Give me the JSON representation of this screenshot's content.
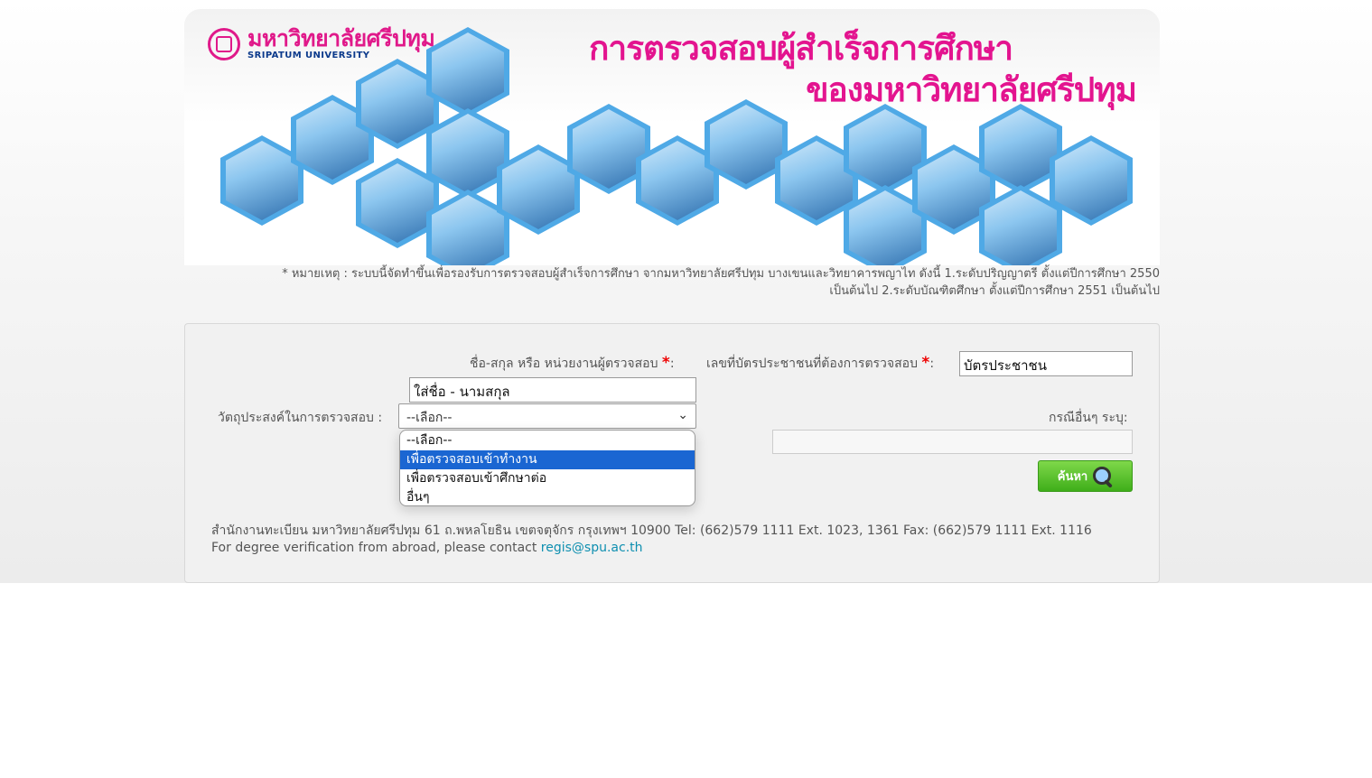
{
  "banner": {
    "logo_th": "มหาวิทยาลัยศรีปทุม",
    "logo_en": "SRIPATUM UNIVERSITY",
    "title_line1": "การตรวจสอบผู้สำเร็จการศึกษา",
    "title_line2": "ของมหาวิทยาลัยศรีปทุม"
  },
  "note": {
    "line1": "* หมายเหตุ : ระบบนี้จัดทำขึ้นเพื่อรองรับการตรวจสอบผู้สำเร็จการศึกษา จากมหาวิทยาลัยศรีปทุม บางเขนและวิทยาคารพญาไท ดังนี้ 1.ระดับปริญญาตรี ตั้งแต่ปีการศึกษา 2550",
    "line2": "เป็นต้นไป 2.ระดับบัณฑิตศึกษา ตั้งแต่ปีการศึกษา 2551 เป็นต้นไป"
  },
  "form": {
    "name_label": "ชื่อ-สกุล หรือ หน่วยงานผู้ตรวจสอบ",
    "name_placeholder": "ใส่ชื่อ - นามสกุล",
    "id_label": "เลขที่บัตรประชาชนที่ต้องการตรวจสอบ",
    "id_placeholder": "บัตรประชาชน",
    "required_mark": "*",
    "colon": ":",
    "purpose_label": "วัตถุประสงค์ในการตรวจสอบ :",
    "purpose_selected": "--เลือก--",
    "purpose_options": [
      "--เลือก--",
      "เพื่อตรวจสอบเข้าทำงาน",
      "เพื่อตรวจสอบเข้าศึกษาต่อ",
      "อื่นๆ"
    ],
    "highlighted_option": 1,
    "other_label": "กรณีอื่นๆ ระบุ:",
    "other_value": "",
    "search_button": "ค้นหา"
  },
  "footer": {
    "line1": "สำนักงานทะเบียน มหาวิทยาลัยศรีปทุม 61 ถ.พหลโยธิน เขตจตุจักร กรุงเทพฯ 10900 Tel: (662)579 1111 Ext. 1023, 1361 Fax: (662)579 1111 Ext. 1116",
    "line2_text": "For degree verification from abroad, please contact ",
    "email": "regis@spu.ac.th"
  },
  "colors": {
    "brand_pink": "#e3148f",
    "link": "#0e8fb0",
    "select_highlight": "#1a66d2",
    "button_green": "#4cba22"
  },
  "icons": {
    "search": "magnifier-icon",
    "dropdown": "chevron-down-icon"
  }
}
